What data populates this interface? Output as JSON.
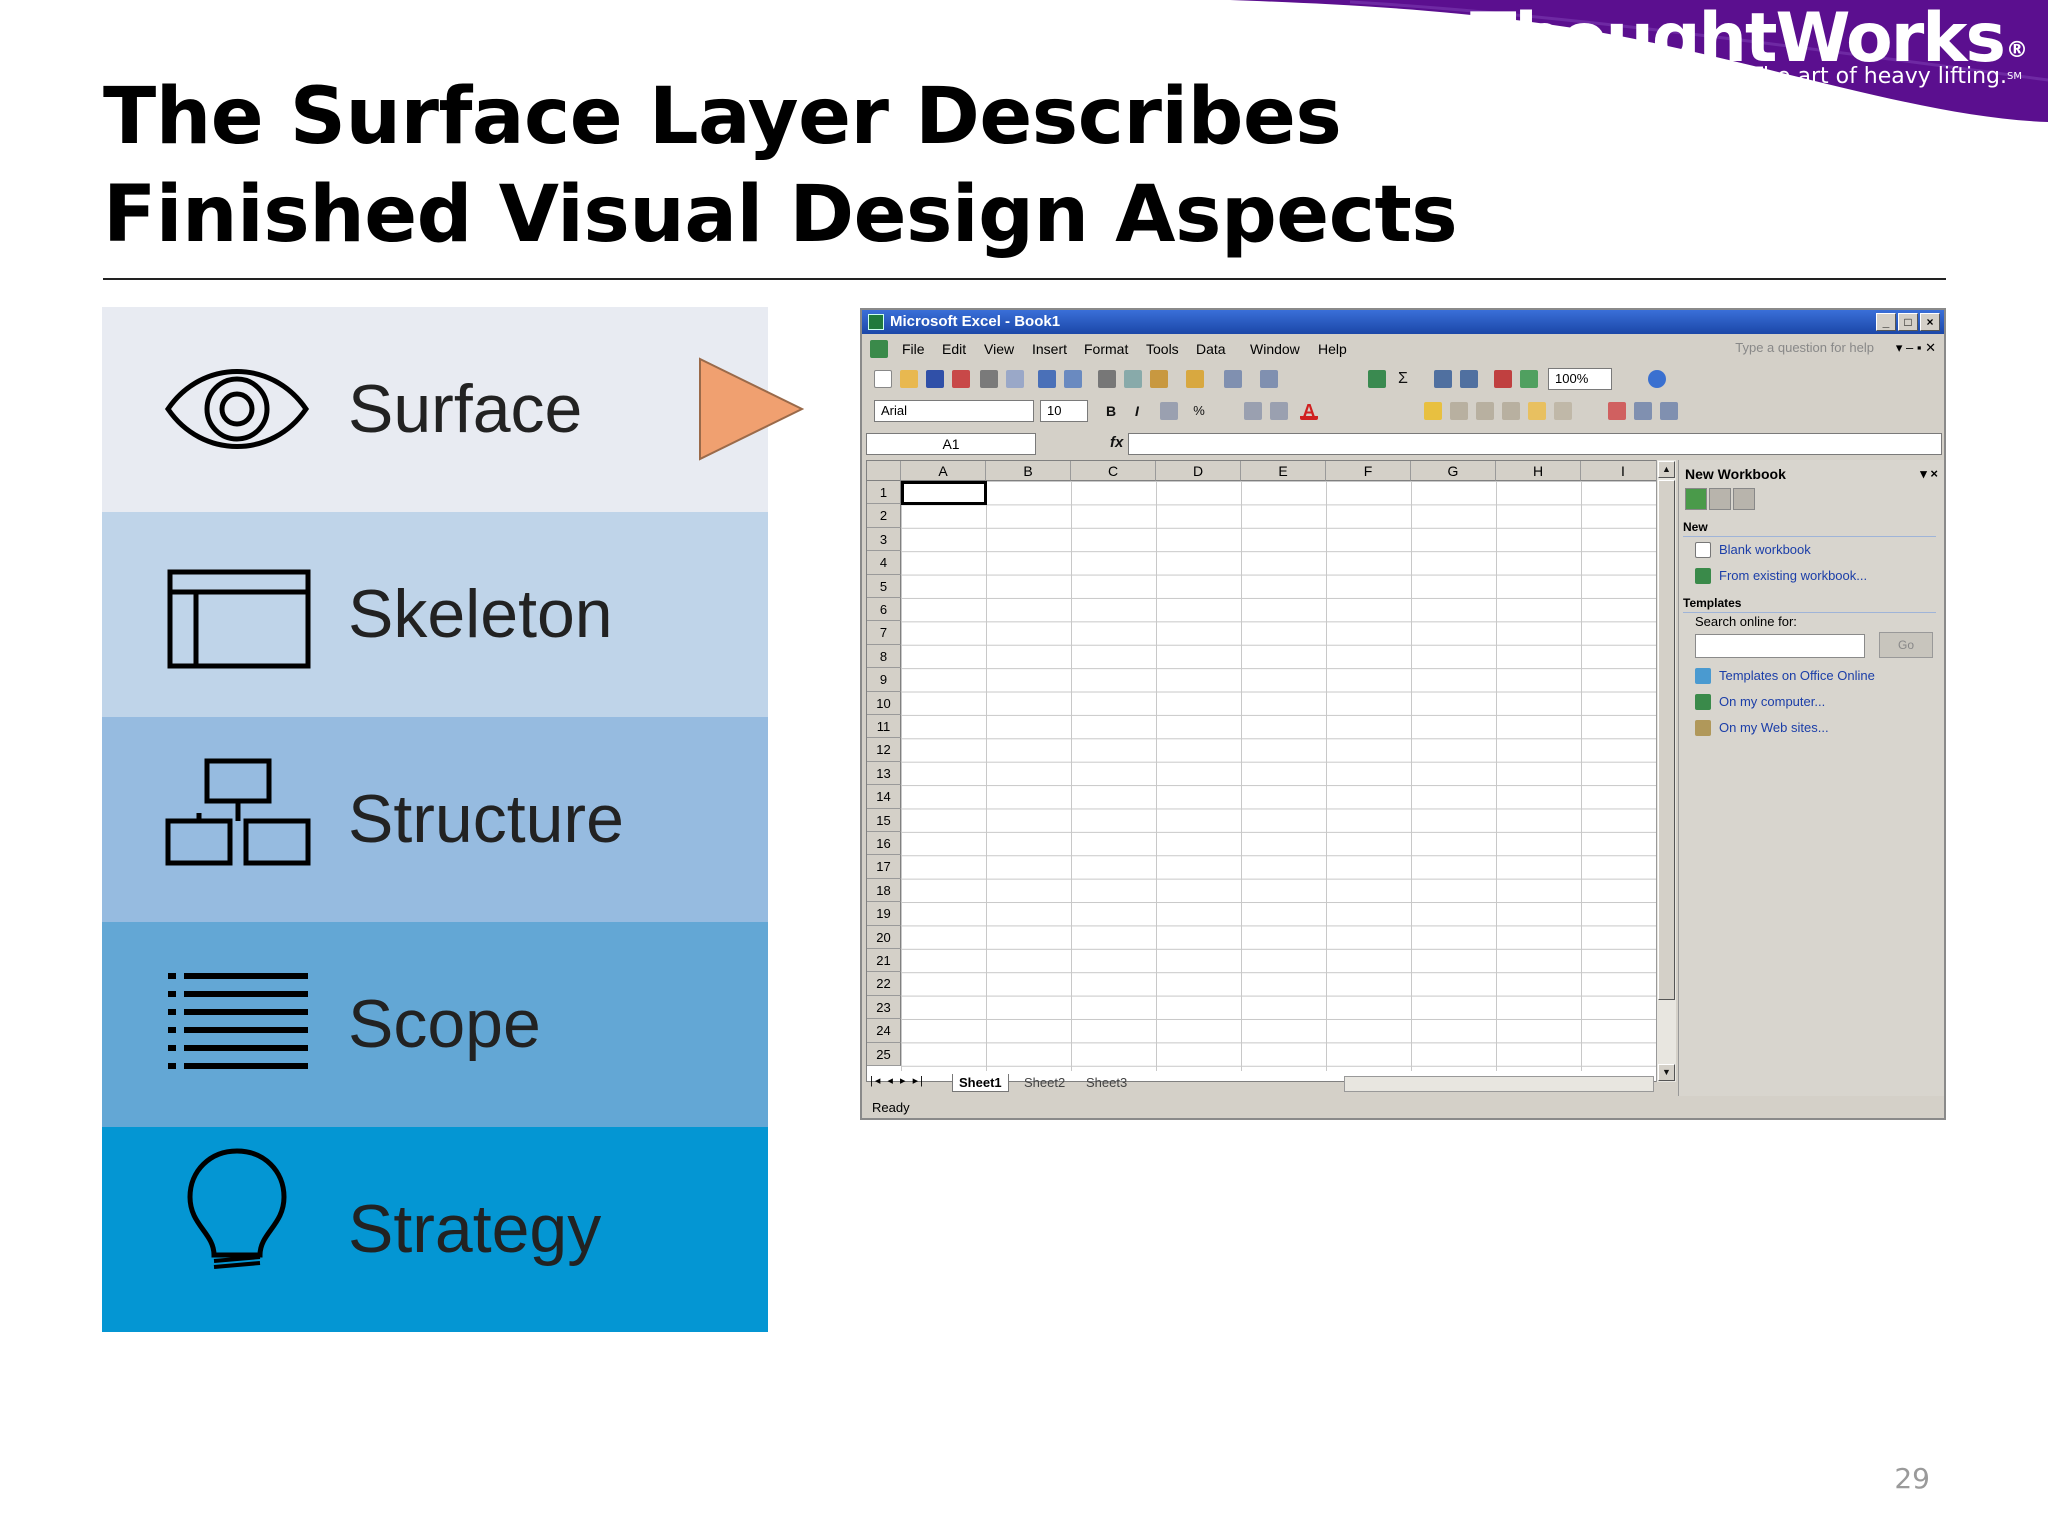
{
  "logo": {
    "name": "ThoughtWorks",
    "registered": "®",
    "tagline": "The art of heavy lifting.",
    "service_mark": "SM",
    "band_color": "#5b0f8f"
  },
  "title": "The Surface Layer Describes Finished Visual Design Aspects",
  "layers": [
    {
      "label": "Surface",
      "icon": "eye-icon",
      "color": "#e8ebf2"
    },
    {
      "label": "Skeleton",
      "icon": "wireframe-layout-icon",
      "color": "#bfd4e9"
    },
    {
      "label": "Structure",
      "icon": "hierarchy-icon",
      "color": "#96bbe0"
    },
    {
      "label": "Scope",
      "icon": "list-icon",
      "color": "#63a7d5"
    },
    {
      "label": "Strategy",
      "icon": "lightbulb-icon",
      "color": "#0496d3"
    }
  ],
  "arrow_color": "#f0a070",
  "excel": {
    "window_title": "Microsoft Excel - Book1",
    "window_buttons": [
      "_",
      "□",
      "×"
    ],
    "menu": [
      "File",
      "Edit",
      "View",
      "Insert",
      "Format",
      "Tools",
      "Data",
      "Window",
      "Help"
    ],
    "question_box": "Type a question for help",
    "font_name": "Arial",
    "font_size": "10",
    "zoom": "100%",
    "name_box": "A1",
    "fx_label": "fx",
    "columns": [
      "A",
      "B",
      "C",
      "D",
      "E",
      "F",
      "G",
      "H",
      "I"
    ],
    "rows": [
      "1",
      "2",
      "3",
      "4",
      "5",
      "6",
      "7",
      "8",
      "9",
      "10",
      "11",
      "12",
      "13",
      "14",
      "15",
      "16",
      "17",
      "18",
      "19",
      "20",
      "21",
      "22",
      "23",
      "24",
      "25"
    ],
    "sheets": [
      "Sheet1",
      "Sheet2",
      "Sheet3"
    ],
    "status": "Ready",
    "task_pane": {
      "title": "New Workbook",
      "section_new": "New",
      "link_blank": "Blank workbook",
      "link_existing": "From existing workbook...",
      "section_templates": "Templates",
      "search_label": "Search online for:",
      "go_button": "Go",
      "link_office_online": "Templates on Office Online",
      "link_my_computer": "On my computer...",
      "link_web_sites": "On my Web sites..."
    }
  },
  "page_number": "29"
}
